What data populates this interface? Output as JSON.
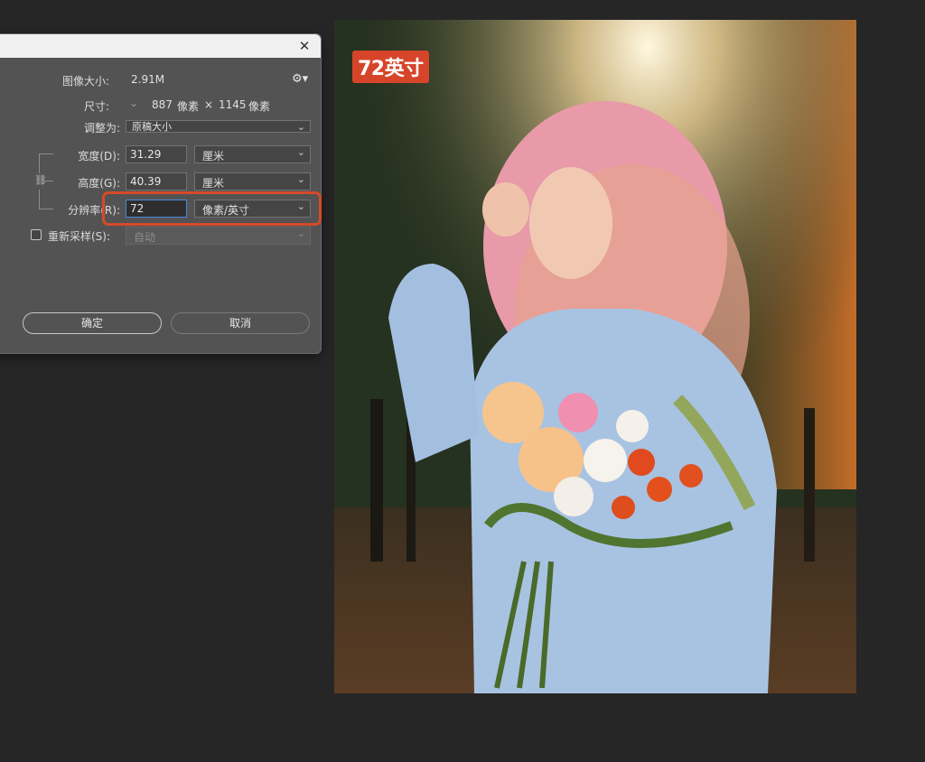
{
  "dialog": {
    "image_size_label": "图像大小:",
    "image_size_value": "2.91M",
    "dimensions_label": "尺寸:",
    "dimensions_width": "887",
    "dimensions_unit1": "像素",
    "dimensions_x": "×",
    "dimensions_height": "1145",
    "dimensions_unit2": "像素",
    "fit_to_label": "调整为:",
    "fit_to_value": "原稿大小",
    "width_label": "宽度(D):",
    "width_value": "31.29",
    "width_unit": "厘米",
    "height_label": "高度(G):",
    "height_value": "40.39",
    "height_unit": "厘米",
    "resolution_label": "分辨率(R):",
    "resolution_value": "72",
    "resolution_unit": "像素/英寸",
    "resample_label": "重新采样(S):",
    "resample_value": "自动",
    "ok_label": "确定",
    "cancel_label": "取消",
    "close_glyph": "✕",
    "gear_glyph": "⚙▾",
    "chevron_glyph": "⌄"
  },
  "image": {
    "overlay_text": "72英寸",
    "description": "portrait photo of a woman with pink wavy hair holding a flower bouquet in an autumn forest"
  },
  "colors": {
    "highlight": "#d64a2a",
    "dialog_bg": "#535353",
    "app_bg": "#262626"
  }
}
